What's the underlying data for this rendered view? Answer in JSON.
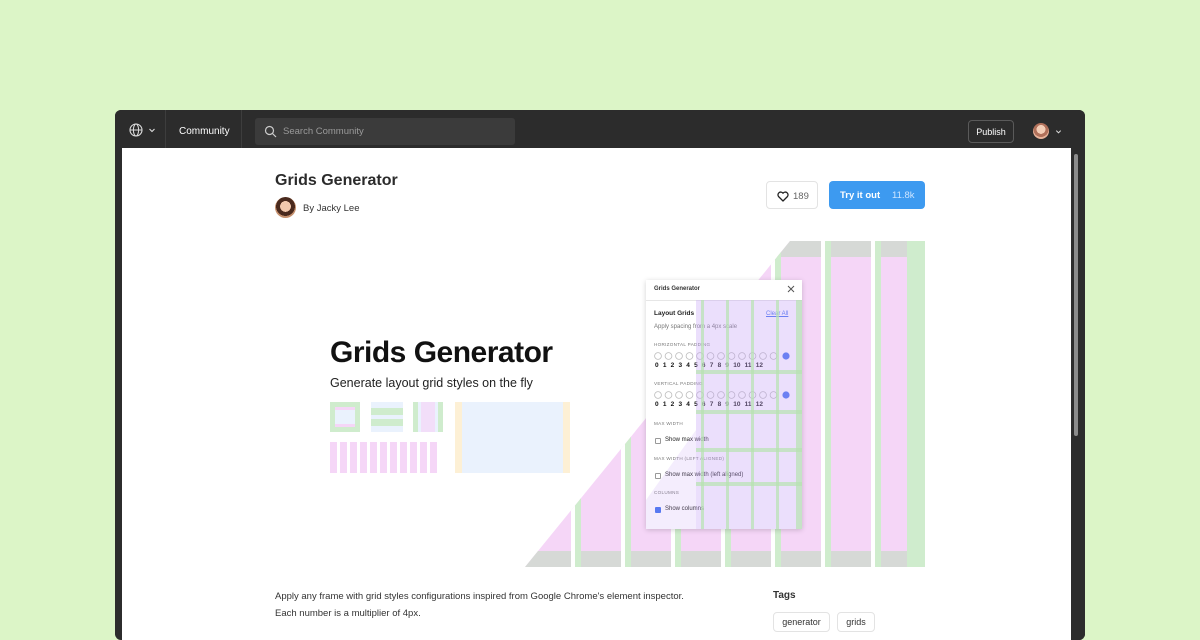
{
  "topbar": {
    "globe_icon": "globe-icon",
    "community_label": "Community",
    "search_placeholder": "Search Community",
    "publish_label": "Publish"
  },
  "plugin": {
    "title": "Grids Generator",
    "author": "By Jacky Lee",
    "likes": "189",
    "try_label": "Try it out",
    "try_count": "11.8k",
    "description": "Apply any frame with grid styles configurations inspired from Google Chrome's element inspector. Each number is a multiplier of 4px.",
    "tags_heading": "Tags",
    "tags": [
      "generator",
      "grids"
    ]
  },
  "hero": {
    "title": "Grids Generator",
    "subtitle": "Generate layout grid styles on the fly"
  },
  "panel": {
    "title": "Grids Generator",
    "section": "Layout Grids",
    "clear_all": "Clear All",
    "hint": "Apply spacing from a 4px scale",
    "horizontal_caption": "HORIZONTAL PADDING",
    "vertical_caption": "VERTICAL PADDING",
    "scale": "0 1 2 3 4 5 6 7 8 9 10 11 12",
    "maxwidth_caption": "MAX WIDTH",
    "maxwidth_option": "Show max width",
    "maxwidth_left_caption": "MAX WIDTH (LEFT ALIGNED)",
    "maxwidth_left_option": "Show max width (left aligned)",
    "columns_caption": "COLUMNS",
    "columns_option": "Show columns",
    "columns_checked": true
  },
  "colors": {
    "background": "#dcf5c7",
    "accent": "#3d9af0",
    "grid_pink": "#f5d6f7",
    "grid_green": "#cfeccd",
    "grid_gray": "#d6d9d6"
  }
}
